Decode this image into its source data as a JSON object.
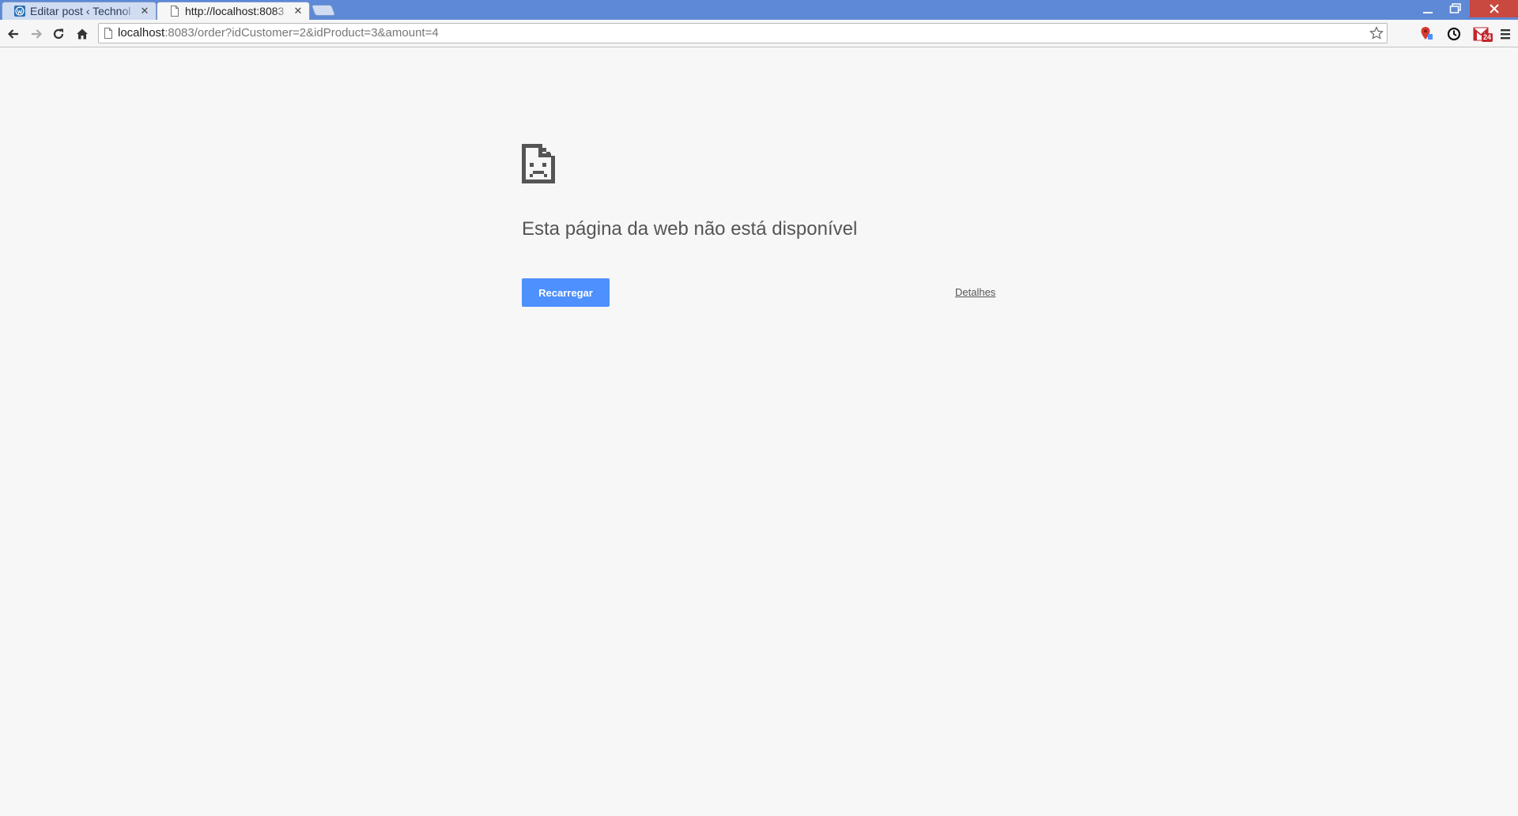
{
  "tabs": [
    {
      "title": "Editar post ‹ Technol",
      "icon": "wordpress-icon",
      "active": false
    },
    {
      "title": "http://localhost:8083",
      "icon": "page-icon",
      "active": true
    }
  ],
  "omnibox": {
    "host": "localhost",
    "rest": ":8083/order?idCustomer=2&idProduct=3&amount=4"
  },
  "extensions": {
    "mail_badge": "24"
  },
  "error_page": {
    "heading": "Esta página da web não está disponível",
    "reload_label": "Recarregar",
    "details_label": "Detalhes"
  },
  "colors": {
    "titlebar": "#5e89d6",
    "page_background": "#f7f7f7",
    "reload_button": "#4d90fe",
    "close_button": "#c9483f"
  }
}
